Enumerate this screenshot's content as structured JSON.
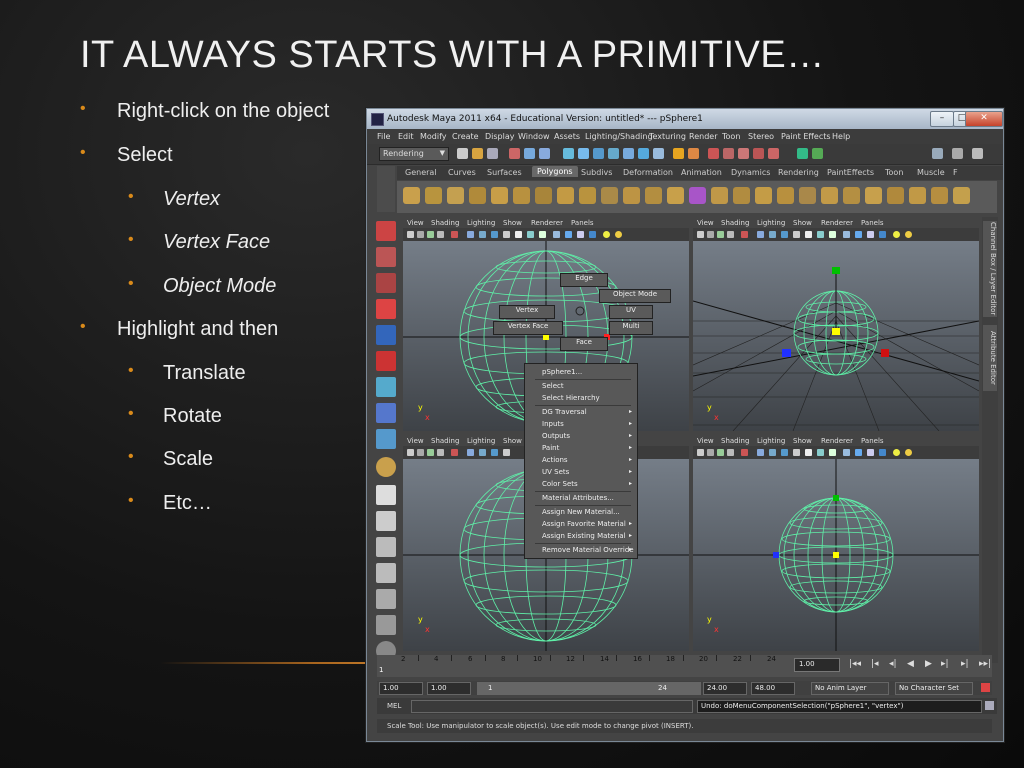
{
  "slide": {
    "title": "IT ALWAYS STARTS WITH A PRIMITIVE…",
    "bullets": [
      {
        "text": "Right-click on the object"
      },
      {
        "text": "Select"
      },
      {
        "text": "Vertex"
      },
      {
        "text": "Vertex Face"
      },
      {
        "text": "Object Mode"
      },
      {
        "text": "Highlight and then"
      },
      {
        "text": "Translate"
      },
      {
        "text": "Rotate"
      },
      {
        "text": "Scale"
      },
      {
        "text": "Etc…"
      }
    ],
    "bullet_symbol": "•",
    "colors": {
      "bullet": "#d98a1a",
      "background": "#141414"
    }
  },
  "maya": {
    "title": "Autodesk Maya 2011 x64 - Educational Version: untitled*   ---   pSphere1",
    "menus": [
      "File",
      "Edit",
      "Modify",
      "Create",
      "Display",
      "Window",
      "Assets",
      "Lighting/Shading",
      "Texturing",
      "Render",
      "Toon",
      "Stereo",
      "Paint Effects",
      "Help"
    ],
    "mode_selector": "Rendering",
    "shelf_tabs": [
      "General",
      "Curves",
      "Surfaces",
      "Polygons",
      "Subdivs",
      "Deformation",
      "Animation",
      "Dynamics",
      "Rendering",
      "PaintEffects",
      "Toon",
      "Muscle",
      "F"
    ],
    "active_shelf_tab": "Polygons",
    "viewport_menu": [
      "View",
      "Shading",
      "Lighting",
      "Show",
      "Renderer",
      "Panels"
    ],
    "marking_menu": {
      "edge": "Edge",
      "object_mode": "Object Mode",
      "vertex": "Vertex",
      "uv": "UV",
      "vertex_face": "Vertex Face",
      "multi": "Multi",
      "face": "Face"
    },
    "context_menu": [
      {
        "label": "pSphere1...",
        "sub": false
      },
      {
        "label": "Select",
        "sub": false
      },
      {
        "label": "Select Hierarchy",
        "sub": false
      },
      {
        "label": "DG Traversal",
        "sub": true
      },
      {
        "label": "Inputs",
        "sub": true
      },
      {
        "label": "Outputs",
        "sub": true
      },
      {
        "label": "Paint",
        "sub": true
      },
      {
        "label": "Actions",
        "sub": true
      },
      {
        "label": "UV Sets",
        "sub": true
      },
      {
        "label": "Color Sets",
        "sub": true
      },
      {
        "label": "Material Attributes...",
        "sub": false
      },
      {
        "label": "Assign New Material...",
        "sub": false
      },
      {
        "label": "Assign Favorite Material",
        "sub": true
      },
      {
        "label": "Assign Existing Material",
        "sub": true
      },
      {
        "label": "Remove Material Override",
        "sub": true
      }
    ],
    "side_tabs": [
      "Channel Box / Layer Editor",
      "Attribute Editor"
    ],
    "axis_labels": {
      "y": "y",
      "x": "x"
    },
    "timeline": {
      "ticks": [
        "2",
        "4",
        "6",
        "8",
        "10",
        "12",
        "14",
        "16",
        "18",
        "20",
        "22",
        "24"
      ],
      "left_frame": "1",
      "current_frame": "1.00"
    },
    "range": {
      "start": "1.00",
      "start2": "1.00",
      "slider_start": "1",
      "slider_end": "24",
      "end": "24.00",
      "end2": "48.00",
      "anim_layer": "No Anim Layer",
      "char_set": "No Character Set"
    },
    "command": {
      "label": "MEL",
      "result": "Undo: doMenuComponentSelection(\"pSphere1\", \"vertex\")"
    },
    "help_line": "Scale Tool: Use manipulator to scale object(s). Use edit mode to change pivot (INSERT).",
    "colors": {
      "wireframe": "#5ff0a8",
      "viewport_top": "#7c8590",
      "viewport_bottom": "#3e4247",
      "titlebar": "#b8c6d6"
    }
  }
}
